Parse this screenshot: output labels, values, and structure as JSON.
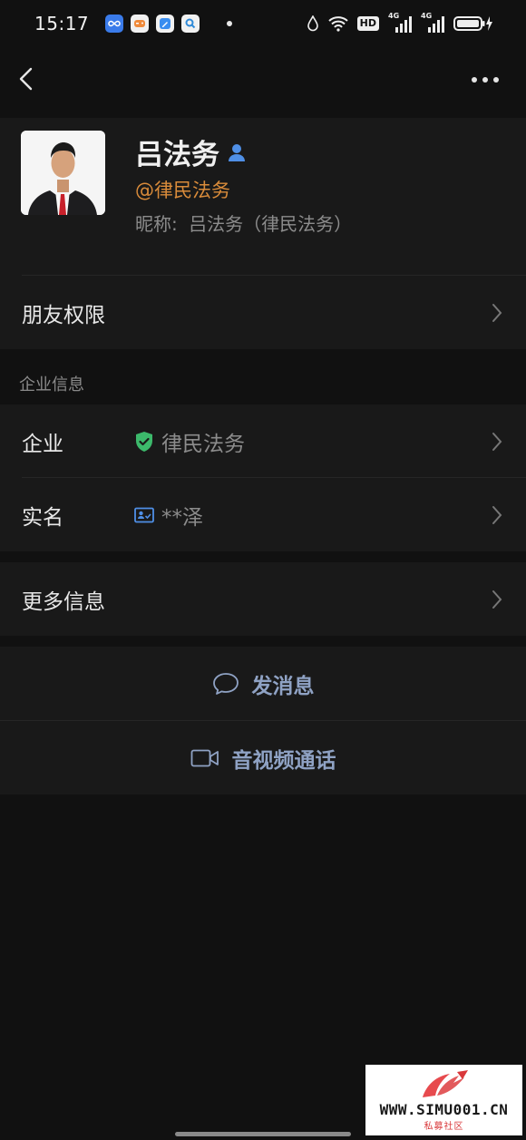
{
  "status_bar": {
    "time": "15:17",
    "app_icons": [
      "infinity-app-icon",
      "game-app-icon",
      "note-app-icon",
      "search-app-icon"
    ],
    "status_icons": [
      "water-drop-icon",
      "wifi-icon",
      "hd-icon",
      "signal-4g-icon",
      "signal-4g-icon",
      "battery-icon"
    ],
    "net_label_1": "4G",
    "net_label_2": "4G",
    "hd_label": "HD"
  },
  "profile": {
    "name": "吕法务",
    "handle": "@律民法务",
    "nickname_label": "昵称:",
    "nickname_value": "吕法务（律民法务）"
  },
  "rows": {
    "friend_permission": "朋友权限",
    "section_enterprise": "企业信息",
    "enterprise_label": "企业",
    "enterprise_value": "律民法务",
    "realname_label": "实名",
    "realname_value": "**泽",
    "more_info": "更多信息"
  },
  "actions": {
    "send_message": "发消息",
    "video_call": "音视频通话"
  },
  "watermark": {
    "text": "WWW.SIMU001.CN",
    "sub": "私募社区"
  },
  "colors": {
    "background": "#111111",
    "card": "#191919",
    "handle": "#d98b3a",
    "action_text": "#8fa2c4",
    "verify_green": "#3cb96b",
    "verify_blue": "#4f8fe6"
  }
}
